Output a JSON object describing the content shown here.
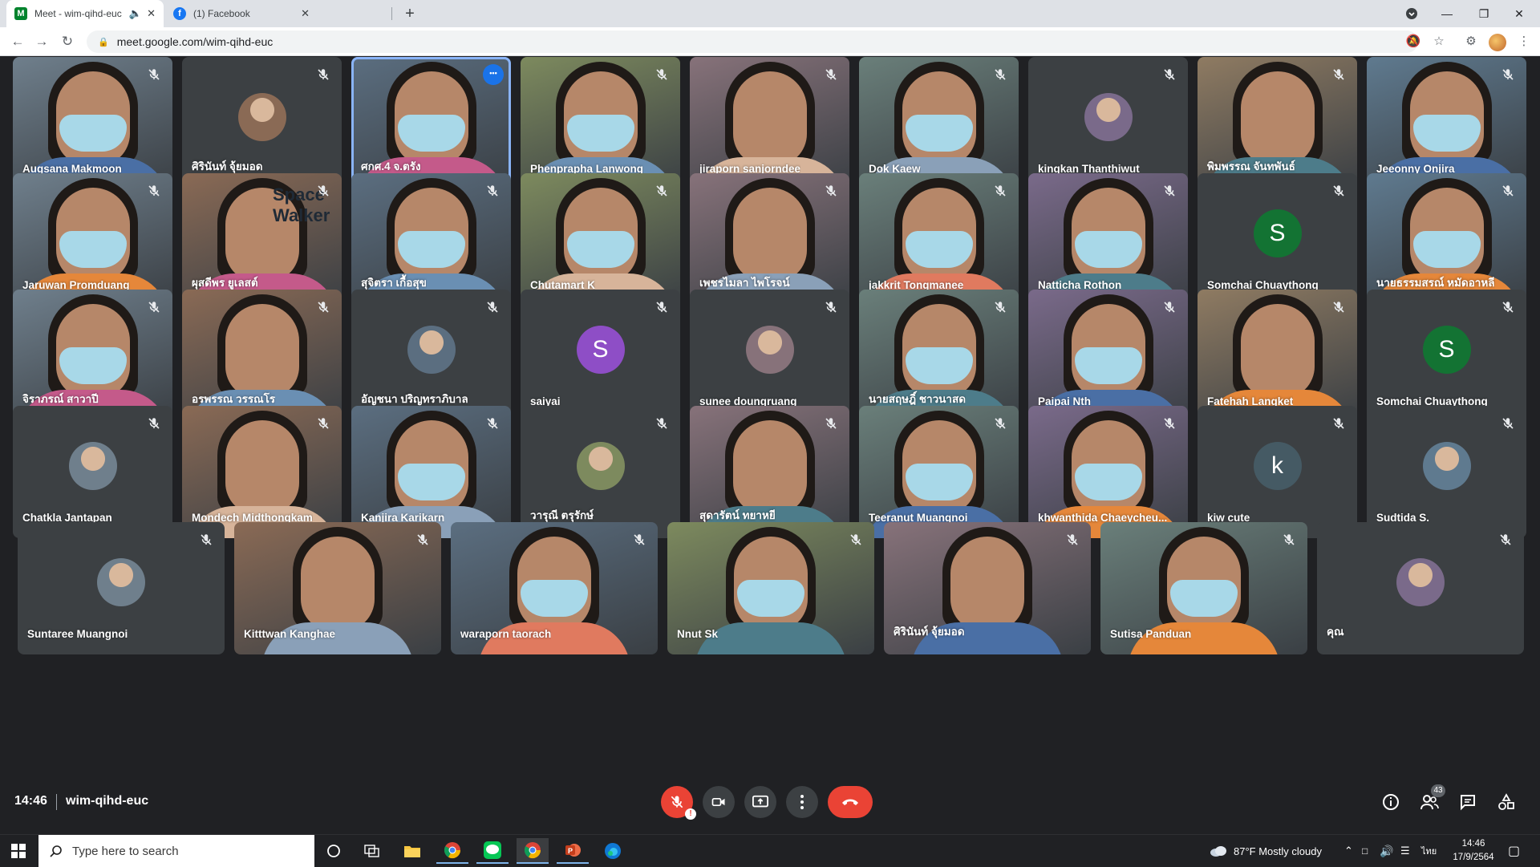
{
  "browser": {
    "tabs": [
      {
        "title": "Meet - wim-qihd-euc",
        "active": true
      },
      {
        "title": "(1) Facebook",
        "active": false
      }
    ],
    "url": "meet.google.com/wim-qihd-euc"
  },
  "colors": {
    "meet_background": "#202124",
    "tile_background": "#3c4043",
    "end_call_red": "#ea4335",
    "active_speaker_outline": "#8ab4f8"
  },
  "participants": [
    {
      "name": "Augsana Makmoon",
      "kind": "video"
    },
    {
      "name": "ศิรินันท์ จุ้ยมอด",
      "kind": "photo"
    },
    {
      "name": "ศกศ.4 จ.ตรัง",
      "kind": "video",
      "active": true
    },
    {
      "name": "Phenprapha Lanwong",
      "kind": "video"
    },
    {
      "name": "jiraporn sanjorndee",
      "kind": "video"
    },
    {
      "name": "Dok Kaew",
      "kind": "video"
    },
    {
      "name": "kingkan Thanthiwut",
      "kind": "photo"
    },
    {
      "name": "พิมพรรณ จันทพันธ์",
      "kind": "video"
    },
    {
      "name": "Jeeonny Onjira",
      "kind": "video"
    },
    {
      "name": "Jaruwan Promduang",
      "kind": "video"
    },
    {
      "name": "ผุสดีพร ยูเลสต์",
      "kind": "video",
      "overlay_text": "Space Walker"
    },
    {
      "name": "สุจิตรา เกื้อสุข",
      "kind": "video"
    },
    {
      "name": "Chutamart K",
      "kind": "video"
    },
    {
      "name": "เพชรไมลา ไพโรจน์",
      "kind": "video"
    },
    {
      "name": "jakkrit Tongmanee",
      "kind": "video"
    },
    {
      "name": "Natticha Rothon",
      "kind": "video"
    },
    {
      "name": "Somchai Chuaythong",
      "kind": "letter",
      "letter": "S",
      "color": "#137333"
    },
    {
      "name": "นายธรรมสรณ์ หมัดอาหลี",
      "kind": "video"
    },
    {
      "name": "จิราภรณ์ สาวาปี",
      "kind": "video"
    },
    {
      "name": "อรพรรณ วรรณโร",
      "kind": "video"
    },
    {
      "name": "อัญชนา ปริญทราภิบาล",
      "kind": "photo"
    },
    {
      "name": "saiyai",
      "kind": "letter",
      "letter": "S",
      "color": "#8e4ec6"
    },
    {
      "name": "sunee doungruang",
      "kind": "photo"
    },
    {
      "name": "นายสฤษฎิ์ ชาวนาสด",
      "kind": "video"
    },
    {
      "name": "Paipai Nth",
      "kind": "video"
    },
    {
      "name": "Fatehah Langket",
      "kind": "video"
    },
    {
      "name": "Somchai Chuaythong",
      "kind": "letter",
      "letter": "S",
      "color": "#137333"
    },
    {
      "name": "Chatkla Jantapan",
      "kind": "photo"
    },
    {
      "name": "Mondech Midthongkam",
      "kind": "video"
    },
    {
      "name": "Kanjira Karikarn",
      "kind": "video"
    },
    {
      "name": "วารุณี ตรุรักษ์",
      "kind": "photo"
    },
    {
      "name": "สุดารัตน์ ทยาหยี",
      "kind": "video"
    },
    {
      "name": "Teeranut Muangnoi",
      "kind": "video"
    },
    {
      "name": "khwanthida Chaeycheu...",
      "kind": "video"
    },
    {
      "name": "kiw cute",
      "kind": "letter",
      "letter": "k",
      "color": "#455a64"
    },
    {
      "name": "Sudtida S.",
      "kind": "photo"
    },
    {
      "name": "Suntaree Muangnoi",
      "kind": "photo"
    },
    {
      "name": "Kitttwan Kanghae",
      "kind": "video"
    },
    {
      "name": "waraporn taorach",
      "kind": "video"
    },
    {
      "name": "Nnut Sk",
      "kind": "video"
    },
    {
      "name": "ศิรินันท์ จุ้ยมอด",
      "kind": "video"
    },
    {
      "name": "Sutisa Panduan",
      "kind": "video"
    },
    {
      "name": "คุณ",
      "kind": "photo"
    }
  ],
  "meeting": {
    "time": "14:46",
    "code": "wim-qihd-euc",
    "people_count": "43",
    "mic_alert": "!"
  },
  "taskbar": {
    "search_placeholder": "Type here to search",
    "weather": "87°F  Mostly cloudy",
    "time": "14:46",
    "date": "17/9/2564",
    "language": "ไทย"
  }
}
